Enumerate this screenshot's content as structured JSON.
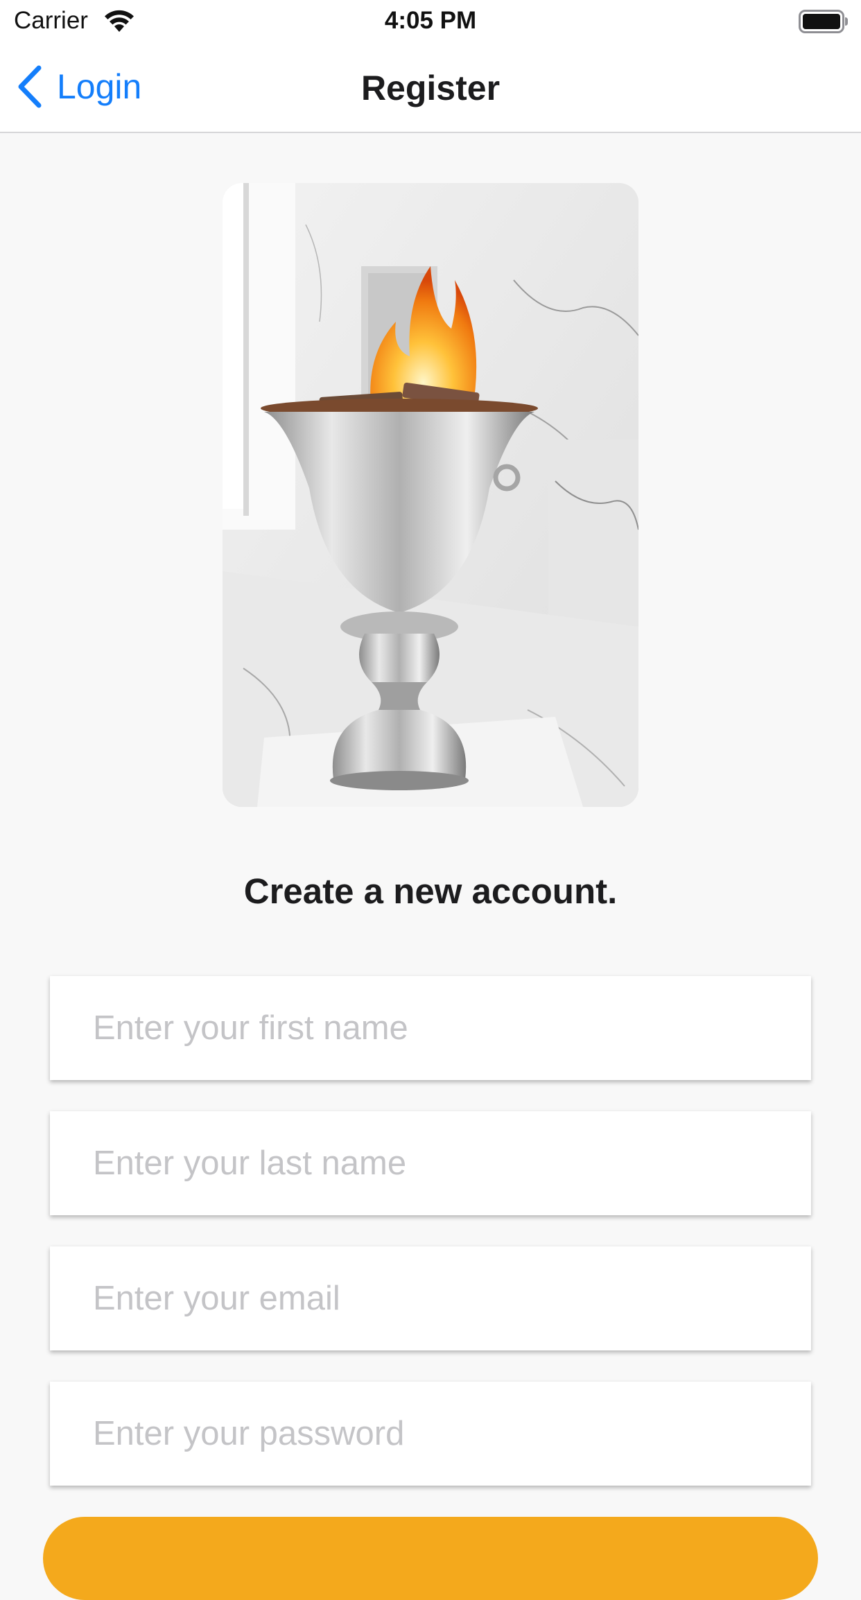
{
  "status_bar": {
    "carrier": "Carrier",
    "time": "4:05 PM",
    "wifi_icon": "wifi-icon",
    "battery_icon": "battery-full-icon"
  },
  "nav": {
    "back_label": "Login",
    "back_icon": "chevron-left-icon",
    "title": "Register"
  },
  "hero": {
    "alt": "Silver urn with a burning fire on a marble floor"
  },
  "heading": "Create a new account.",
  "form": {
    "first_name_placeholder": "Enter your first name",
    "last_name_placeholder": "Enter your last name",
    "email_placeholder": "Enter your email",
    "password_placeholder": "Enter your password",
    "first_name_value": "",
    "last_name_value": "",
    "email_value": "",
    "password_value": ""
  },
  "colors": {
    "accent_blue": "#147efb",
    "button_orange": "#f4a91c",
    "background": "#f8f8f8",
    "placeholder_gray": "#c4c4c7"
  }
}
